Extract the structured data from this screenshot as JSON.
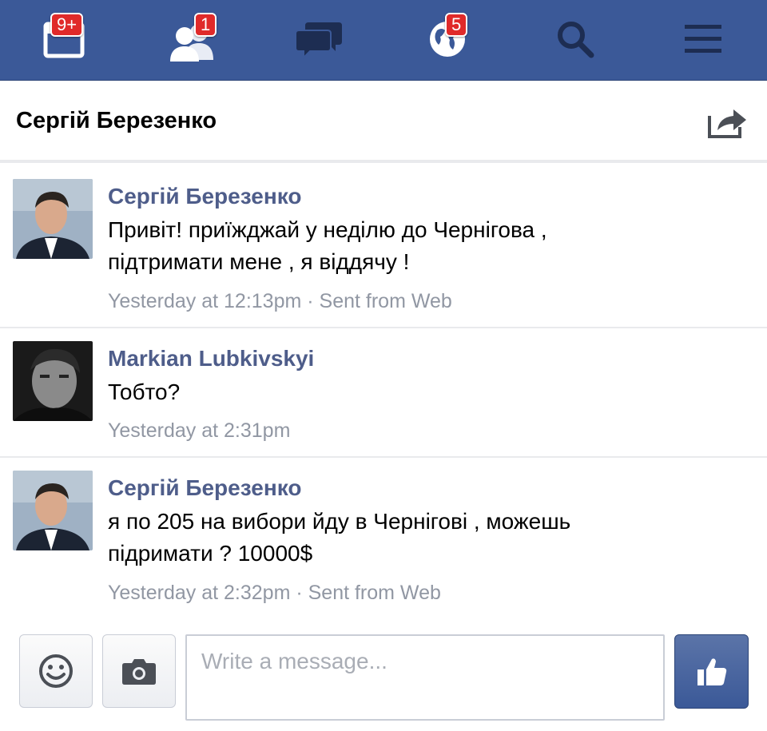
{
  "topbar": {
    "icons": [
      {
        "name": "friend-requests-icon",
        "badge": "9+"
      },
      {
        "name": "friends-icon",
        "badge": "1"
      },
      {
        "name": "messages-icon",
        "badge": ""
      },
      {
        "name": "notifications-globe-icon",
        "badge": "5"
      },
      {
        "name": "search-icon",
        "badge": ""
      },
      {
        "name": "menu-icon",
        "badge": ""
      }
    ],
    "bg_color": "#3b5998",
    "badge_color": "#e02a2a"
  },
  "conversation": {
    "title": "Сергій Березенко",
    "share_icon": "share-icon"
  },
  "messages": [
    {
      "sender": "Сергій Березенко",
      "lines": [
        "Привіт! приїжджай у неділю до Чернігова ,",
        "підтримати мене , я віддячу !"
      ],
      "meta": "Yesterday at 12:13pm · Sent from Web"
    },
    {
      "sender": "Markian Lubkivskyi",
      "lines": [
        "Тобто?"
      ],
      "meta": "Yesterday at 2:31pm"
    },
    {
      "sender": "Сергій Березенко",
      "lines": [
        "я по 205 на вибори йду в Чернігові , можешь",
        "підримати ? 10000$"
      ],
      "meta": "Yesterday at 2:32pm · Sent from Web"
    }
  ],
  "composer": {
    "placeholder": "Write a message...",
    "emoji_icon": "smiley-icon",
    "camera_icon": "camera-icon",
    "like_icon": "thumbs-up-icon"
  }
}
